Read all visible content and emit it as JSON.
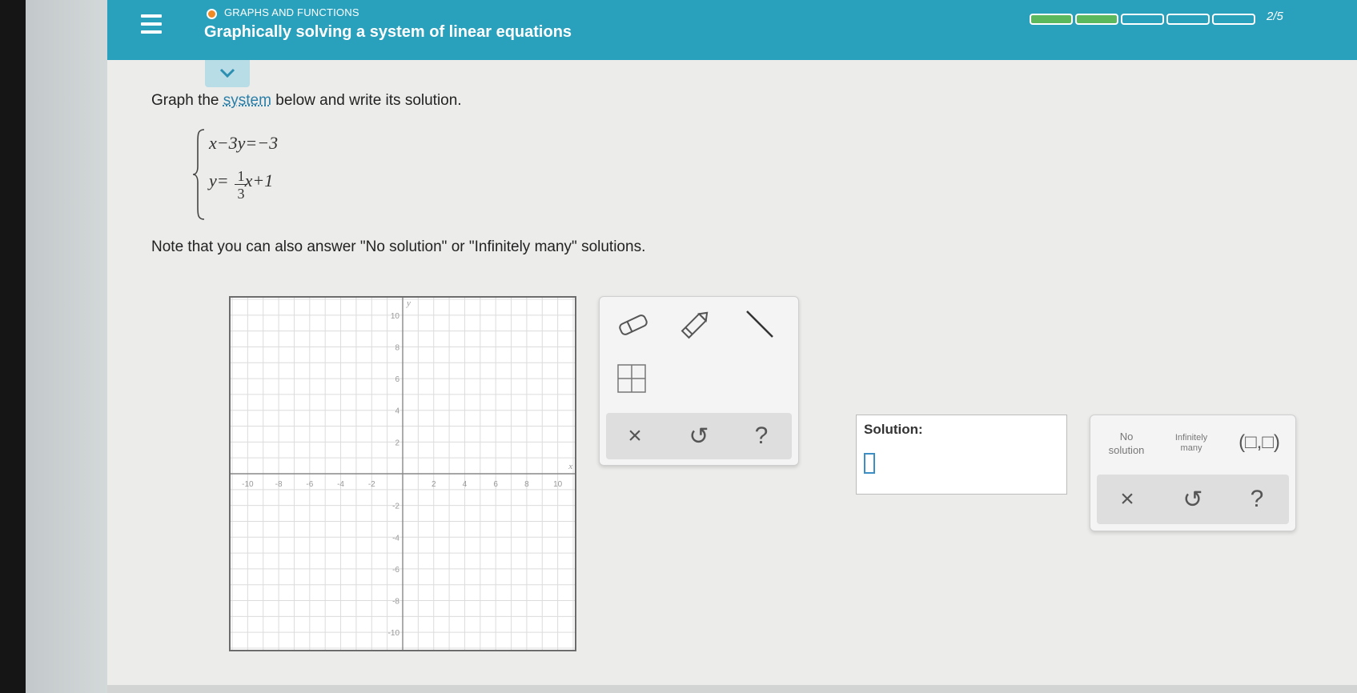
{
  "header": {
    "topic": "GRAPHS AND FUNCTIONS",
    "title": "Graphically solving a system of linear equations",
    "progress_text": "2/5",
    "progress": {
      "completed": 2,
      "total": 5
    }
  },
  "problem": {
    "instruction_before": "Graph the ",
    "instruction_link": "system",
    "instruction_after": " below and write its solution.",
    "equation1": "x−3y=−3",
    "equation2_prefix": "y=",
    "equation2_frac_num": "1",
    "equation2_frac_den": "3",
    "equation2_suffix": "x+1",
    "note": "Note that you can also answer \"No solution\" or \"Infinitely many\" solutions."
  },
  "graph": {
    "x_axis_label": "x",
    "y_axis_label": "y",
    "x_tick_labels": [
      "-10",
      "-8",
      "-6",
      "-4",
      "-2",
      "2",
      "4",
      "6",
      "8",
      "10"
    ],
    "y_tick_labels": [
      "10",
      "8",
      "6",
      "4",
      "2",
      "-2",
      "-4",
      "-6",
      "-8",
      "-10"
    ]
  },
  "graph_tools": {
    "eraser_icon": "eraser-icon",
    "pencil_icon": "pencil-icon",
    "line_icon": "line-icon",
    "table_icon": "table-icon",
    "clear": "×",
    "undo": "↺",
    "help": "?"
  },
  "solution": {
    "label": "Solution:"
  },
  "answer_choices": {
    "no_solution_line1": "No",
    "no_solution_line2": "solution",
    "infinitely_line1": "Infinitely",
    "infinitely_line2": "many",
    "ordered_pair": "(□,□)",
    "clear": "×",
    "undo": "↺",
    "help": "?"
  },
  "colors": {
    "header": "#2aa1bc",
    "progress_done": "#5cb85c",
    "link": "#2a7fa8",
    "topic_dot": "#f08a24"
  }
}
